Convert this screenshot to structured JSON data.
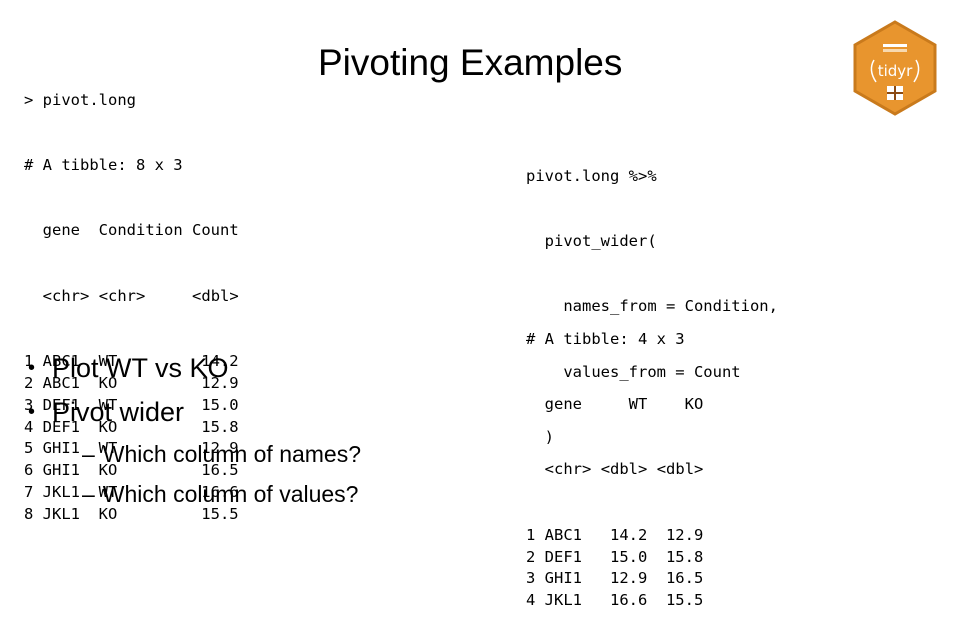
{
  "slide": {
    "title": "Pivoting Examples"
  },
  "logo": {
    "label": "tidyr",
    "icon": "tidyr-hex-logo",
    "color": "#E8952E"
  },
  "long_output": {
    "prompt_line": "> pivot.long",
    "tibble_line": "# A tibble: 8 x 3",
    "headers": [
      "gene",
      "Condition",
      "Count"
    ],
    "types": [
      "<chr>",
      "<chr>",
      "<dbl>"
    ],
    "rows": [
      {
        "idx": "1",
        "gene": "ABC1",
        "condition": "WT",
        "count": "14.2"
      },
      {
        "idx": "2",
        "gene": "ABC1",
        "condition": "KO",
        "count": "12.9"
      },
      {
        "idx": "3",
        "gene": "DEF1",
        "condition": "WT",
        "count": "15.0"
      },
      {
        "idx": "4",
        "gene": "DEF1",
        "condition": "KO",
        "count": "15.8"
      },
      {
        "idx": "5",
        "gene": "GHI1",
        "condition": "WT",
        "count": "12.9"
      },
      {
        "idx": "6",
        "gene": "GHI1",
        "condition": "KO",
        "count": "16.5"
      },
      {
        "idx": "7",
        "gene": "JKL1",
        "condition": "WT",
        "count": "16.6"
      },
      {
        "idx": "8",
        "gene": "JKL1",
        "condition": "KO",
        "count": "15.5"
      }
    ]
  },
  "code": {
    "lines": [
      "pivot.long %>%",
      "  pivot_wider(",
      "    names_from = Condition,",
      "    values_from = Count",
      "  )"
    ]
  },
  "wide_output": {
    "tibble_line": "# A tibble: 4 x 3",
    "headers": [
      "gene",
      "WT",
      "KO"
    ],
    "types": [
      "<chr>",
      "<dbl>",
      "<dbl>"
    ],
    "rows": [
      {
        "idx": "1",
        "gene": "ABC1",
        "wt": "14.2",
        "ko": "12.9"
      },
      {
        "idx": "2",
        "gene": "DEF1",
        "wt": "15.0",
        "ko": "15.8"
      },
      {
        "idx": "3",
        "gene": "GHI1",
        "wt": "12.9",
        "ko": "16.5"
      },
      {
        "idx": "4",
        "gene": "JKL1",
        "wt": "16.6",
        "ko": "15.5"
      }
    ]
  },
  "bullets": {
    "items": [
      {
        "marker": "•",
        "text": "Plot WT vs KO"
      },
      {
        "marker": "•",
        "text": "Pivot wider"
      }
    ],
    "subitems": [
      {
        "marker": "–",
        "text": "Which column of names?"
      },
      {
        "marker": "–",
        "text": "Which column of values?"
      }
    ]
  }
}
